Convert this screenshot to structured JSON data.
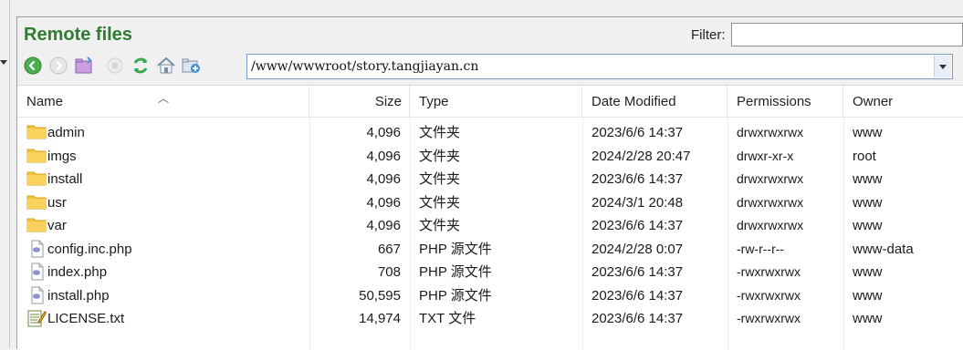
{
  "panel": {
    "title": "Remote files",
    "filter_label": "Filter:",
    "filter_value": ""
  },
  "path": {
    "value": "/www/wwwroot/story.tangjiayan.cn"
  },
  "toolbar": [
    {
      "name": "back-icon"
    },
    {
      "name": "forward-icon"
    },
    {
      "name": "open-folder-icon"
    },
    {
      "name": "stop-icon"
    },
    {
      "name": "refresh-icon"
    },
    {
      "name": "home-icon"
    },
    {
      "name": "new-folder-icon"
    }
  ],
  "columns": [
    "Name",
    "Size",
    "Type",
    "Date Modified",
    "Permissions",
    "Owner"
  ],
  "files": [
    {
      "name": "admin",
      "size": "4,096",
      "type": "文件夹",
      "date": "2023/6/6 14:37",
      "perm": "drwxrwxrwx",
      "owner": "www",
      "icon": "folder-icon"
    },
    {
      "name": "imgs",
      "size": "4,096",
      "type": "文件夹",
      "date": "2024/2/28 20:47",
      "perm": "drwxr-xr-x",
      "owner": "root",
      "icon": "folder-icon"
    },
    {
      "name": "install",
      "size": "4,096",
      "type": "文件夹",
      "date": "2023/6/6 14:37",
      "perm": "drwxrwxrwx",
      "owner": "www",
      "icon": "folder-icon"
    },
    {
      "name": "usr",
      "size": "4,096",
      "type": "文件夹",
      "date": "2024/3/1 20:48",
      "perm": "drwxrwxrwx",
      "owner": "www",
      "icon": "folder-icon"
    },
    {
      "name": "var",
      "size": "4,096",
      "type": "文件夹",
      "date": "2023/6/6 14:37",
      "perm": "drwxrwxrwx",
      "owner": "www",
      "icon": "folder-icon"
    },
    {
      "name": "config.inc.php",
      "size": "667",
      "type": "PHP 源文件",
      "date": "2024/2/28 0:07",
      "perm": "-rw-r--r--",
      "owner": "www-data",
      "icon": "php-file-icon"
    },
    {
      "name": "index.php",
      "size": "708",
      "type": "PHP 源文件",
      "date": "2023/6/6 14:37",
      "perm": "-rwxrwxrwx",
      "owner": "www",
      "icon": "php-file-icon"
    },
    {
      "name": "install.php",
      "size": "50,595",
      "type": "PHP 源文件",
      "date": "2023/6/6 14:37",
      "perm": "-rwxrwxrwx",
      "owner": "www",
      "icon": "php-file-icon"
    },
    {
      "name": "LICENSE.txt",
      "size": "14,974",
      "type": "TXT 文件",
      "date": "2023/6/6 14:37",
      "perm": "-rwxrwxrwx",
      "owner": "www",
      "icon": "text-file-icon"
    }
  ],
  "colors": {
    "title": "#2e7d32",
    "folder": "#f5c342"
  }
}
